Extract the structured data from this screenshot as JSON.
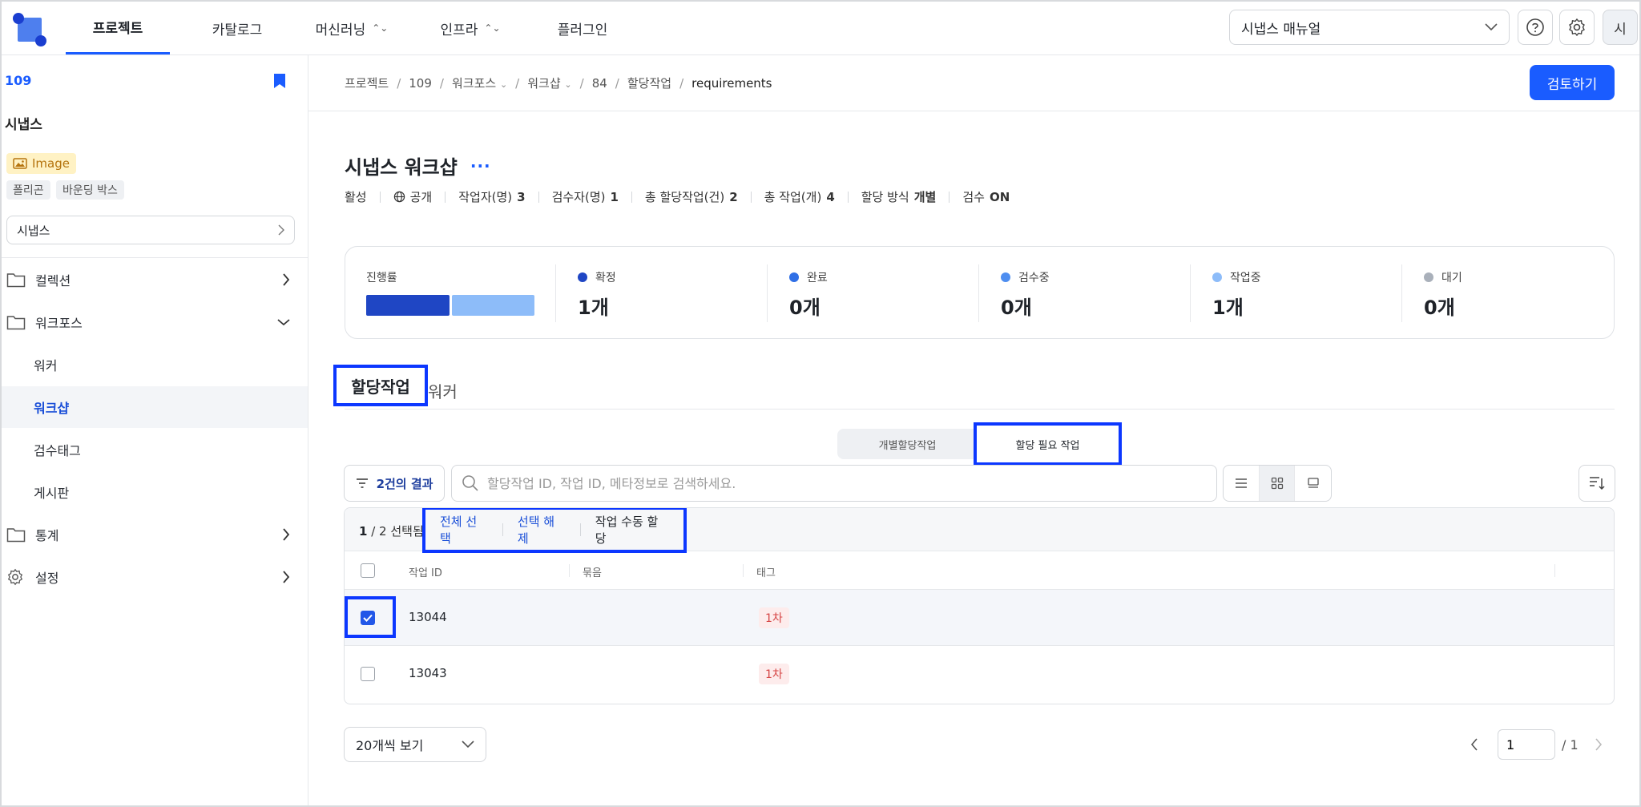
{
  "topnav": {
    "tabs": [
      {
        "label": "프로젝트",
        "active": true
      },
      {
        "label": "카탈로그"
      },
      {
        "label": "머신러닝",
        "dropdown": true
      },
      {
        "label": "인프라",
        "dropdown": true
      },
      {
        "label": "플러그인"
      }
    ],
    "doc_select": "시냅스 매뉴얼",
    "avatar": "시"
  },
  "sidebar": {
    "project_number": "109",
    "project_name": "시냅스",
    "type_tag": "Image",
    "chips": [
      "폴리곤",
      "바운딩 박스"
    ],
    "selector": "시냅스",
    "items": [
      {
        "label": "컬렉션",
        "icon": "folder-icon",
        "expanded": false
      },
      {
        "label": "워크포스",
        "icon": "folder-icon",
        "expanded": true
      },
      {
        "label": "통계",
        "icon": "folder-icon",
        "expanded": false
      },
      {
        "label": "설정",
        "icon": "gear-icon",
        "expanded": false
      }
    ],
    "sub_items": [
      {
        "label": "워커"
      },
      {
        "label": "워크샵",
        "active": true
      },
      {
        "label": "검수태그"
      },
      {
        "label": "게시판"
      }
    ]
  },
  "breadcrumb": [
    {
      "label": "프로젝트"
    },
    {
      "label": "109"
    },
    {
      "label": "워크포스",
      "dropdown": true
    },
    {
      "label": "워크샵",
      "dropdown": true
    },
    {
      "label": "84"
    },
    {
      "label": "할당작업"
    },
    {
      "label": "requirements"
    }
  ],
  "review_button": "검토하기",
  "workshop": {
    "title": "시냅스 워크샵",
    "more": "···",
    "meta": {
      "status": "활성",
      "visibility": "공개",
      "workers_label": "작업자(명)",
      "workers_value": "3",
      "reviewers_label": "검수자(명)",
      "reviewers_value": "1",
      "assign_total_label": "총 할당작업(건)",
      "assign_total_value": "2",
      "tasks_total_label": "총 작업(개)",
      "tasks_total_value": "4",
      "assign_method_label": "할당 방식",
      "assign_method_value": "개별",
      "review_label": "검수",
      "review_value": "ON"
    }
  },
  "stats": {
    "progress_label": "진행률",
    "progress_fraction": 0.5,
    "items": [
      {
        "label": "확정",
        "value": "1개",
        "color": "#1f46c4"
      },
      {
        "label": "완료",
        "value": "0개",
        "color": "#2f6fe6"
      },
      {
        "label": "검수중",
        "value": "0개",
        "color": "#4e8ef0"
      },
      {
        "label": "작업중",
        "value": "1개",
        "color": "#8dbcf9"
      },
      {
        "label": "대기",
        "value": "0개",
        "color": "#a9b0ba"
      }
    ]
  },
  "tabs": [
    {
      "label": "할당작업",
      "active": true
    },
    {
      "label": "워커"
    }
  ],
  "segment": [
    {
      "label": "개별할당작업"
    },
    {
      "label": "할당 필요 작업",
      "active": true
    }
  ],
  "toolbar": {
    "result_count": "2건의 결과",
    "search_placeholder": "할당작업 ID, 작업 ID, 메타정보로 검색하세요."
  },
  "table": {
    "selected": "1",
    "total": "/ 2",
    "selected_suffix": "선택됨",
    "actions": [
      "전체 선택",
      "선택 해제",
      "작업 수동 할당"
    ],
    "columns": [
      "작업 ID",
      "묶음",
      "태그"
    ],
    "rows": [
      {
        "id": "13044",
        "bundle": "",
        "tag": "1차",
        "checked": true
      },
      {
        "id": "13043",
        "bundle": "",
        "tag": "1차",
        "checked": false
      }
    ]
  },
  "pagination": {
    "page_size": "20개씩 보기",
    "current_page": "1",
    "total_pages": "/ 1"
  },
  "colors": {
    "accent": "#1a5cff",
    "highlight": "#0c37ff"
  }
}
